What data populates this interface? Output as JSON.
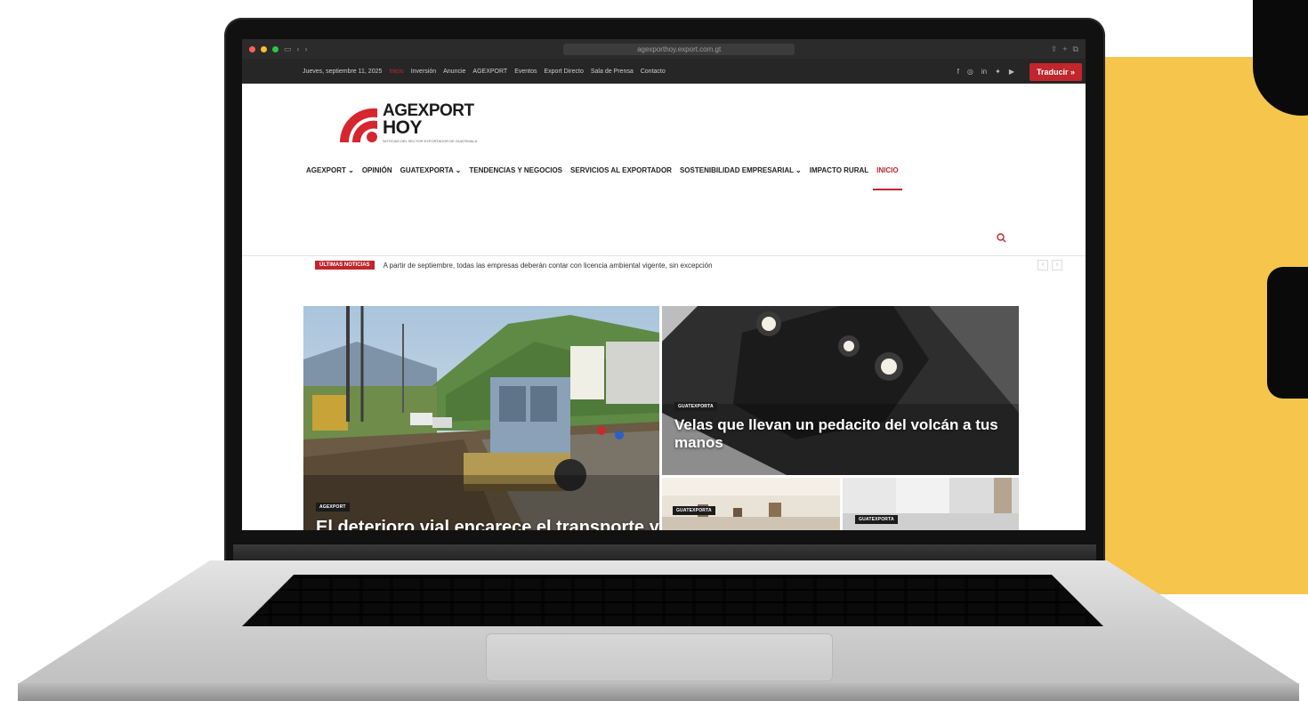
{
  "browser": {
    "url": "agexporthoy.export.com.gt"
  },
  "topbar": {
    "date": "Jueves, septiembre 11, 2025",
    "links": [
      "Inicio",
      "Inversión",
      "Anuncie",
      "AGEXPORT",
      "Eventos",
      "Export Directo",
      "Sala de Prensa",
      "Contacto"
    ],
    "social_icons": [
      "facebook-icon",
      "instagram-icon",
      "linkedin-icon",
      "twitter-icon",
      "youtube-icon"
    ],
    "translate_label": "Traducir »"
  },
  "logo": {
    "line1": "AGEXPORT",
    "line2": "HOY",
    "tagline": "NOTICIAS DEL SECTOR EXPORTADOR DE GUATEMALA"
  },
  "nav": {
    "items": [
      {
        "label": "AGEXPORT ⌄",
        "active": false
      },
      {
        "label": "OPINIÓN",
        "active": false
      },
      {
        "label": "GUATEXPORTA ⌄",
        "active": false
      },
      {
        "label": "TENDENCIAS Y NEGOCIOS",
        "active": false
      },
      {
        "label": "SERVICIOS AL EXPORTADOR",
        "active": false
      },
      {
        "label": "SOSTENIBILIDAD EMPRESARIAL ⌄",
        "active": false
      },
      {
        "label": "IMPACTO RURAL",
        "active": false
      },
      {
        "label": "INICIO",
        "active": true
      }
    ]
  },
  "ticker": {
    "label": "ÚLTIMAS NOTICIAS",
    "text": "A partir de septiembre, todas las empresas deberán contar con licencia ambiental vigente, sin excepción"
  },
  "featured": {
    "main": {
      "category": "AGEXPORT",
      "headline": "El deterioro vial encarece el transporte y"
    },
    "right_top": {
      "category": "GUATEXPORTA",
      "headline": "Velas que llevan un pedacito del volcán a tus manos"
    },
    "right_bottom_left": {
      "category": "GUATEXPORTA"
    },
    "right_bottom_right": {
      "category": "GUATEXPORTA"
    }
  },
  "colors": {
    "accent": "#c0262c",
    "background_panel": "#f6c54b"
  }
}
